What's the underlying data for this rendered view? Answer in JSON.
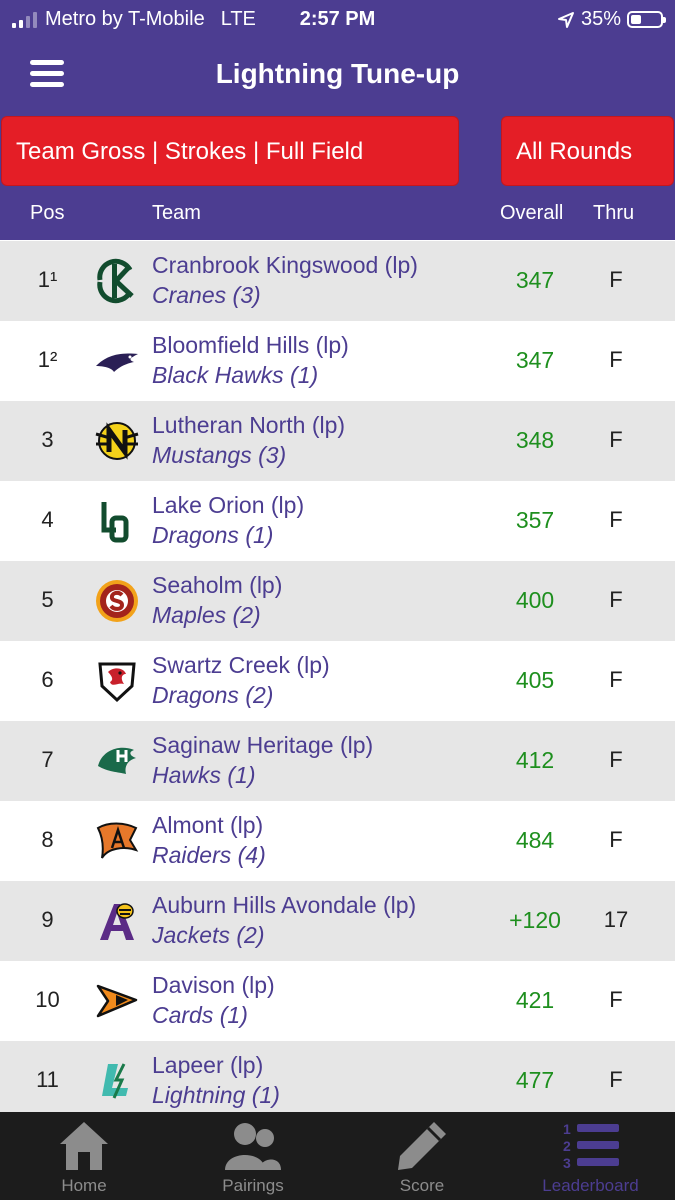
{
  "status_bar": {
    "carrier": "Metro by T-Mobile",
    "network": "LTE",
    "time": "2:57 PM",
    "battery": "35%",
    "battery_level": 0.35
  },
  "header": {
    "title": "Lightning Tune-up"
  },
  "filters": {
    "main": "Team Gross | Strokes | Full Field",
    "rounds": "All Rounds"
  },
  "columns": {
    "pos": "Pos",
    "team": "Team",
    "overall": "Overall",
    "thru": "Thru"
  },
  "rows": [
    {
      "pos": "1¹",
      "team": "Cranbrook Kingswood (lp)",
      "mascot": "Cranes (3)",
      "overall": "347",
      "thru": "F",
      "logo": "cranbrook-kc-logo"
    },
    {
      "pos": "1²",
      "team": "Bloomfield Hills (lp)",
      "mascot": "Black Hawks (1)",
      "overall": "347",
      "thru": "F",
      "logo": "black-hawk-logo"
    },
    {
      "pos": "3",
      "team": "Lutheran North (lp)",
      "mascot": "Mustangs (3)",
      "overall": "348",
      "thru": "F",
      "logo": "mustang-n-logo"
    },
    {
      "pos": "4",
      "team": "Lake Orion (lp)",
      "mascot": "Dragons (1)",
      "overall": "357",
      "thru": "F",
      "logo": "lo-logo"
    },
    {
      "pos": "5",
      "team": "Seaholm (lp)",
      "mascot": "Maples (2)",
      "overall": "400",
      "thru": "F",
      "logo": "seaholm-s-logo"
    },
    {
      "pos": "6",
      "team": "Swartz Creek (lp)",
      "mascot": "Dragons (2)",
      "overall": "405",
      "thru": "F",
      "logo": "dragon-shield-logo"
    },
    {
      "pos": "7",
      "team": "Saginaw Heritage (lp)",
      "mascot": "Hawks (1)",
      "overall": "412",
      "thru": "F",
      "logo": "hawk-h-logo"
    },
    {
      "pos": "8",
      "team": "Almont (lp)",
      "mascot": "Raiders (4)",
      "overall": "484",
      "thru": "F",
      "logo": "raider-flag-logo"
    },
    {
      "pos": "9",
      "team": "Auburn Hills Avondale (lp)",
      "mascot": "Jackets (2)",
      "overall": "+120",
      "thru": "17",
      "logo": "yellow-jacket-a-logo"
    },
    {
      "pos": "10",
      "team": "Davison (lp)",
      "mascot": "Cards (1)",
      "overall": "421",
      "thru": "F",
      "logo": "cardinal-logo"
    },
    {
      "pos": "11",
      "team": "Lapeer (lp)",
      "mascot": "Lightning (1)",
      "overall": "477",
      "thru": "F",
      "logo": "lightning-l-logo"
    }
  ],
  "tabs": [
    {
      "label": "Home",
      "icon": "home-icon",
      "active": false
    },
    {
      "label": "Pairings",
      "icon": "people-icon",
      "active": false
    },
    {
      "label": "Score",
      "icon": "pencil-icon",
      "active": false
    },
    {
      "label": "Leaderboard",
      "icon": "leaderboard-list-icon",
      "active": true
    }
  ],
  "colors": {
    "brand_purple": "#4c3d91",
    "filter_red": "#e41e26",
    "score_green": "#1e8f1e",
    "tab_bar": "#1c1c1c"
  }
}
